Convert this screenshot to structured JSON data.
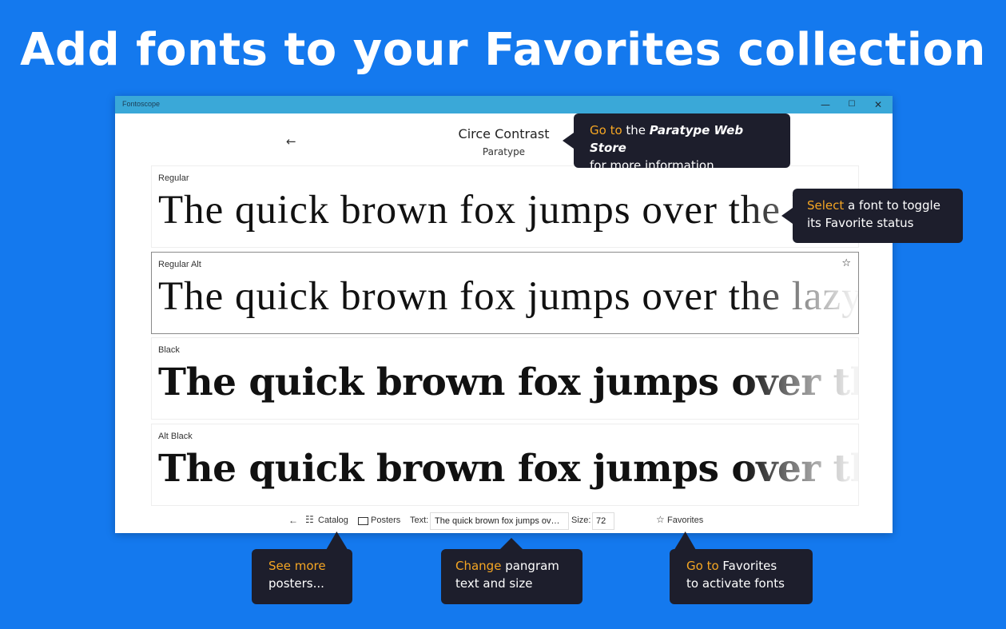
{
  "headline": "Add fonts to your Favorites collection",
  "window": {
    "title": "Fontoscope",
    "controls": {
      "minimize": "—",
      "maximize": "☐",
      "close": "✕"
    }
  },
  "header": {
    "back_icon": "←",
    "font_name": "Circe Contrast",
    "foundry": "Paratype"
  },
  "samples": [
    {
      "label": "Regular",
      "text": "The quick brown fox jumps over the lazy dog",
      "style": "light",
      "selected": false
    },
    {
      "label": "Regular Alt",
      "text": "The quick brown fox jumps over the lazy dog",
      "style": "light",
      "selected": true,
      "star_icon": "☆"
    },
    {
      "label": "Black",
      "text": "The quick brown fox jumps over the lazy dog",
      "style": "heavy",
      "selected": false
    },
    {
      "label": "Alt Black",
      "text": "The quick brown fox jumps over the lazy dog",
      "style": "heavy",
      "selected": false
    }
  ],
  "toolbar": {
    "back_icon": "←",
    "catalog_icon": "☷",
    "catalog_label": "Catalog",
    "posters_label": "Posters",
    "text_label": "Text:",
    "text_value": "The quick brown fox jumps over the lazy dog",
    "size_label": "Size:",
    "size_value": "72",
    "favorites_icon": "☆",
    "favorites_label": "Favorites"
  },
  "callouts": {
    "store": {
      "highlight": "Go to",
      "mid": " the ",
      "brand": "Paratype Web Store",
      "line2": "for more information"
    },
    "select": {
      "highlight": "Select",
      "rest": " a font to toggle",
      "line2": "its Favorite status"
    },
    "posters": {
      "highlight": "See more",
      "line2": "posters..."
    },
    "pangram": {
      "highlight": "Change",
      "rest": " pangram",
      "line2": "text and size"
    },
    "favorites": {
      "highlight": "Go to",
      "rest": " Favorites",
      "line2": "to activate fonts"
    }
  },
  "colors": {
    "background": "#1479ee",
    "titlebar": "#3aa8d8",
    "callout_bg": "#1d1e2c",
    "callout_highlight": "#f5a623"
  }
}
